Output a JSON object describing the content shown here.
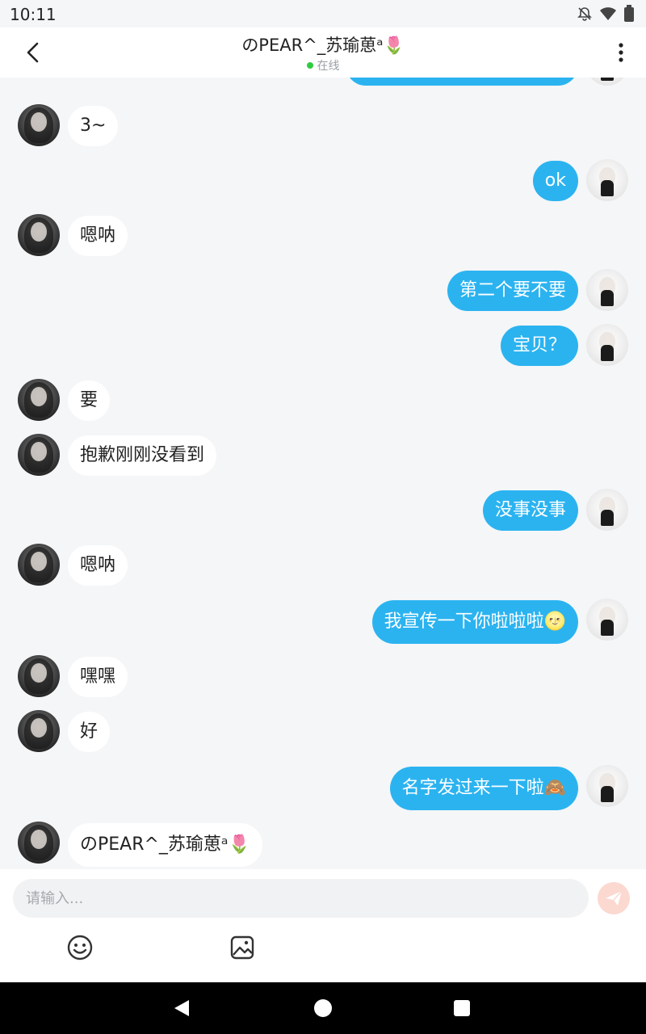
{
  "status_bar": {
    "time": "10:11"
  },
  "header": {
    "title": "のPEAR^_苏瑜葸ᵃ🌷",
    "status": "在线"
  },
  "messages": [
    {
      "side": "right",
      "text": ""
    },
    {
      "side": "left",
      "text": "3~"
    },
    {
      "side": "right",
      "text": "ok"
    },
    {
      "side": "left",
      "text": "嗯呐"
    },
    {
      "side": "right",
      "text": "第二个要不要"
    },
    {
      "side": "right",
      "text": "宝贝？"
    },
    {
      "side": "left",
      "text": "要"
    },
    {
      "side": "left",
      "text": "抱歉刚刚没看到"
    },
    {
      "side": "right",
      "text": "没事没事"
    },
    {
      "side": "left",
      "text": "嗯呐"
    },
    {
      "side": "right",
      "text": "我宣传一下你啦啦啦🌝"
    },
    {
      "side": "left",
      "text": "嘿嘿"
    },
    {
      "side": "left",
      "text": "好"
    },
    {
      "side": "right",
      "text": "名字发过来一下啦🙈"
    },
    {
      "side": "left",
      "text": "のPEAR^_苏瑜葸ᵃ🌷"
    }
  ],
  "input": {
    "placeholder": "请输入..."
  },
  "icons": {
    "back": "chevron-left-icon",
    "more": "more-vertical-icon",
    "send": "send-icon",
    "emoji": "emoji-icon",
    "image": "image-icon"
  },
  "colors": {
    "sent_bubble": "#2bb3f0",
    "received_bubble": "#ffffff",
    "online": "#2ecc40",
    "send_button": "#fbd9d0"
  }
}
